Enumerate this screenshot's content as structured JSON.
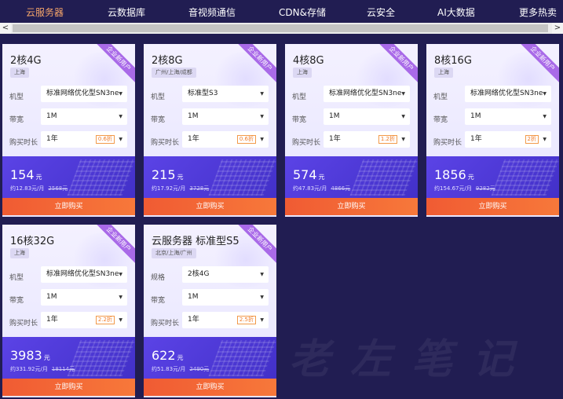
{
  "tabs": [
    {
      "label": "云服务器",
      "active": true
    },
    {
      "label": "云数据库",
      "active": false
    },
    {
      "label": "音视频通信",
      "active": false
    },
    {
      "label": "CDN&存储",
      "active": false
    },
    {
      "label": "云安全",
      "active": false
    },
    {
      "label": "AI大数据",
      "active": false
    },
    {
      "label": "更多热卖",
      "active": false
    }
  ],
  "scrollbar": {
    "left_arrow": "<",
    "right_arrow": ">"
  },
  "badge": "企业新用户",
  "labels": {
    "type": "机型",
    "spec": "规格",
    "bandwidth": "带宽",
    "duration": "购买时长",
    "currency": "元",
    "buy": "立即购买"
  },
  "cards": [
    {
      "title": "2核4G",
      "region": "上海",
      "row1_label": "机型",
      "row1_value": "标准网络优化型SN3ne",
      "bandwidth": "1M",
      "duration": "1年",
      "discount": "0.6折",
      "price": "154",
      "monthly": "约12.83元/月",
      "original": "2568元"
    },
    {
      "title": "2核8G",
      "region": "广州/上海/成都",
      "row1_label": "机型",
      "row1_value": "标准型S3",
      "bandwidth": "1M",
      "duration": "1年",
      "discount": "0.6折",
      "price": "215",
      "monthly": "约17.92元/月",
      "original": "3728元"
    },
    {
      "title": "4核8G",
      "region": "上海",
      "row1_label": "机型",
      "row1_value": "标准网络优化型SN3ne",
      "bandwidth": "1M",
      "duration": "1年",
      "discount": "1.2折",
      "price": "574",
      "monthly": "约47.83元/月",
      "original": "4866元"
    },
    {
      "title": "8核16G",
      "region": "上海",
      "row1_label": "机型",
      "row1_value": "标准网络优化型SN3ne",
      "bandwidth": "1M",
      "duration": "1年",
      "discount": "2折",
      "price": "1856",
      "monthly": "约154.67元/月",
      "original": "9282元"
    },
    {
      "title": "16核32G",
      "region": "上海",
      "row1_label": "机型",
      "row1_value": "标准网络优化型SN3ne",
      "bandwidth": "1M",
      "duration": "1年",
      "discount": "2.2折",
      "price": "3983",
      "monthly": "约331.92元/月",
      "original": "18114元"
    },
    {
      "title": "云服务器 标准型S5",
      "region": "北京/上海/广州",
      "row1_label": "规格",
      "row1_value": "2核4G",
      "bandwidth": "1M",
      "duration": "1年",
      "discount": "2.5折",
      "price": "622",
      "monthly": "约51.83元/月",
      "original": "2490元"
    }
  ],
  "watermark": "老左笔记",
  "colors": {
    "background": "#211d52",
    "active_tab": "#f5a56a",
    "buy_button": "#f05b33",
    "price_panel": "#4f3bd8"
  }
}
